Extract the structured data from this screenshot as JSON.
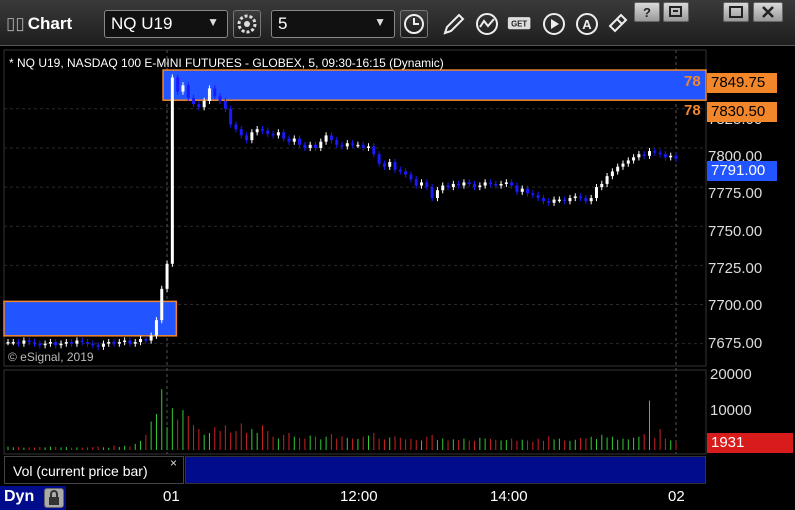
{
  "toolbar": {
    "title": "Chart",
    "symbol": "NQ U19",
    "interval": "5",
    "icons": [
      "settings-gear-icon",
      "clock-icon",
      "pencil-draw-icon",
      "study-icon",
      "get-icon",
      "play-icon",
      "alert-icon",
      "link-icon"
    ],
    "window_buttons": [
      "help-icon",
      "restore-icon",
      "maximize-icon",
      "close-icon"
    ]
  },
  "chart": {
    "header": "* NQ U19, NASDAQ 100 E-MINI FUTURES - GLOBEX, 5, 09:30-16:15 (Dynamic)",
    "watermark": "© eSignal, 2019",
    "price_labels": [
      "7825.00",
      "7800.00",
      "7775.00",
      "7750.00",
      "7725.00",
      "7700.00",
      "7675.00"
    ],
    "flags": {
      "upper_line_label": "78",
      "upper_line_value": "7849.75",
      "lower_line_label": "78",
      "lower_line_value": "7830.50",
      "current_price": "7791.00"
    },
    "colors": {
      "background": "#000000",
      "zone_fill": "#2255ff",
      "zone_border": "#f2862b",
      "up_candle": "#ffffff",
      "down_candle": "#1a1aff",
      "vol_up": "#33cc33",
      "vol_down": "#cc2222"
    }
  },
  "volume": {
    "label": "Vol (current price bar)",
    "close_glyph": "×",
    "scale_labels": [
      "20000",
      "10000"
    ],
    "current_value": "1931"
  },
  "bottom": {
    "mode": "Dyn",
    "time_labels": [
      "01",
      "12:00",
      "14:00",
      "02"
    ]
  },
  "chart_data": {
    "type": "candlestick",
    "symbol": "NQ U19",
    "ylim": [
      7662,
      7860
    ],
    "zones": [
      {
        "from": 7830.5,
        "to": 7849.75,
        "start_bar": 30,
        "end_bar": 128
      },
      {
        "from": 7680,
        "to": 7702,
        "start_bar": 0,
        "end_bar": 31
      }
    ],
    "closes": [
      7676,
      7676,
      7675,
      7677,
      7676,
      7675,
      7674,
      7675,
      7676,
      7674,
      7675,
      7676,
      7675,
      7677,
      7676,
      7675,
      7674,
      7673,
      7675,
      7676,
      7675,
      7676,
      7677,
      7675,
      7676,
      7678,
      7677,
      7680,
      7690,
      7710,
      7726,
      7845,
      7836,
      7840,
      7832,
      7828,
      7826,
      7830,
      7838,
      7833,
      7830,
      7825,
      7815,
      7812,
      7808,
      7805,
      7810,
      7812,
      7811,
      7809,
      7808,
      7810,
      7806,
      7804,
      7806,
      7802,
      7800,
      7802,
      7800,
      7804,
      7808,
      7805,
      7802,
      7801,
      7803,
      7802,
      7802,
      7800,
      7801,
      7796,
      7790,
      7788,
      7791,
      7786,
      7785,
      7783,
      7780,
      7776,
      7778,
      7775,
      7768,
      7773,
      7776,
      7775,
      7777,
      7776,
      7778,
      7777,
      7775,
      7776,
      7778,
      7777,
      7776,
      7777,
      7778,
      7776,
      7772,
      7774,
      7771,
      7770,
      7768,
      7766,
      7765,
      7767,
      7767,
      7766,
      7768,
      7769,
      7768,
      7766,
      7768,
      7775,
      7777,
      7782,
      7785,
      7788,
      7790,
      7792,
      7794,
      7796,
      7795,
      7798,
      7797,
      7796,
      7794,
      7795,
      7793
    ],
    "volume": [
      900,
      700,
      800,
      600,
      700,
      650,
      800,
      700,
      900,
      850,
      700,
      800,
      600,
      700,
      650,
      700,
      800,
      900,
      700,
      600,
      1200,
      800,
      1100,
      900,
      1600,
      2400,
      4000,
      7500,
      9500,
      16000,
      6000,
      11000,
      8000,
      10500,
      9000,
      6500,
      5500,
      4000,
      4500,
      6000,
      5000,
      6500,
      4500,
      5000,
      7000,
      4500,
      5500,
      4500,
      6500,
      5000,
      3500,
      3000,
      4000,
      4500,
      3500,
      3200,
      3000,
      3800,
      3500,
      2800,
      3500,
      4200,
      3000,
      3600,
      3200,
      3000,
      2900,
      3500,
      3800,
      4500,
      3000,
      2800,
      3300,
      3600,
      3200,
      2800,
      3000,
      2600,
      2500,
      3500,
      4000,
      2600,
      3000,
      2500,
      2800,
      2600,
      3000,
      2500,
      2400,
      3200,
      3000,
      2900,
      2700,
      2500,
      2600,
      3000,
      2400,
      2700,
      2500,
      2200,
      3000,
      2400,
      3600,
      2800,
      3000,
      2500,
      2400,
      2700,
      3200,
      3000,
      3500,
      2900,
      4000,
      3300,
      3500,
      2700,
      3000,
      2800,
      3200,
      3500,
      4200,
      13000,
      3200,
      5500,
      3000,
      2500,
      1931
    ]
  }
}
